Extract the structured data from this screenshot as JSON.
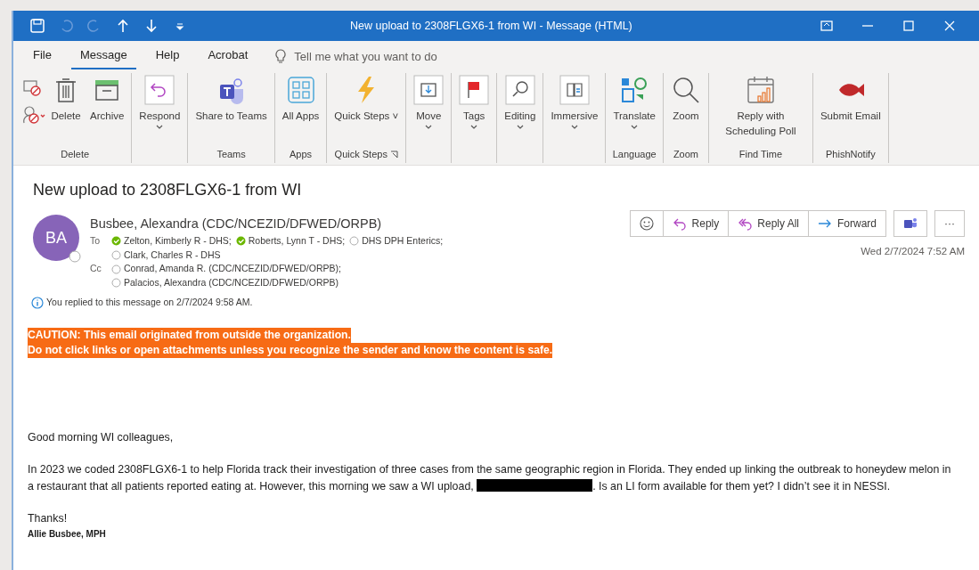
{
  "window": {
    "title": "New upload to 2308FLGX6-1 from WI  -  Message (HTML)"
  },
  "ribbon_tabs": [
    {
      "label": "File",
      "selected": false
    },
    {
      "label": "Message",
      "selected": true
    },
    {
      "label": "Help",
      "selected": false
    },
    {
      "label": "Acrobat",
      "selected": false
    }
  ],
  "tell_me": {
    "placeholder": "Tell me what you want to do"
  },
  "ribbon_groups": [
    {
      "label": "Delete",
      "buttons": [
        {
          "kind": "small-stack"
        },
        {
          "kind": "large",
          "label": "Delete",
          "dropdown": false
        },
        {
          "kind": "large",
          "label": "Archive",
          "dropdown": false
        }
      ]
    },
    {
      "buttons": [
        {
          "kind": "large",
          "label": "Respond",
          "dropdown": true
        }
      ]
    },
    {
      "label": "Teams",
      "buttons": [
        {
          "kind": "large",
          "label": "Share to Teams",
          "dropdown": false
        }
      ]
    },
    {
      "label": "Apps",
      "buttons": [
        {
          "kind": "large",
          "label": "All Apps",
          "dropdown": false
        }
      ]
    },
    {
      "label": "Quick Steps",
      "launcher": true,
      "buttons": [
        {
          "kind": "large",
          "label": "Quick Steps ˅",
          "dropdown": false
        }
      ]
    },
    {
      "buttons": [
        {
          "kind": "large",
          "label": "Move",
          "dropdown": true
        }
      ]
    },
    {
      "buttons": [
        {
          "kind": "large",
          "label": "Tags",
          "dropdown": true
        }
      ]
    },
    {
      "buttons": [
        {
          "kind": "large",
          "label": "Editing",
          "dropdown": true
        }
      ]
    },
    {
      "buttons": [
        {
          "kind": "large",
          "label": "Immersive",
          "dropdown": true
        }
      ]
    },
    {
      "label": "Language",
      "buttons": [
        {
          "kind": "large",
          "label": "Translate",
          "dropdown": true
        }
      ]
    },
    {
      "label": "Zoom",
      "buttons": [
        {
          "kind": "large",
          "label": "Zoom",
          "dropdown": false
        }
      ]
    },
    {
      "label": "Find Time",
      "buttons": [
        {
          "kind": "large",
          "label": "Reply with Scheduling Poll",
          "dropdown": false
        }
      ]
    },
    {
      "label": "PhishNotify",
      "buttons": [
        {
          "kind": "large",
          "label": "Submit Email",
          "dropdown": false
        }
      ]
    }
  ],
  "message": {
    "subject": "New upload to 2308FLGX6-1 from WI",
    "avatar_initials": "BA",
    "sender": "Busbee, Alexandra (CDC/NCEZID/DFWED/ORPB)",
    "to_label": "To",
    "to": [
      {
        "name": "Zelton, Kimberly R - DHS;",
        "online": true
      },
      {
        "name": "Roberts, Lynn T - DHS;",
        "online": true
      },
      {
        "name": "DHS DPH Enterics;",
        "online": false
      },
      {
        "name": "Clark, Charles R - DHS",
        "online": false
      }
    ],
    "cc_label": "Cc",
    "cc": [
      {
        "name": "Conrad, Amanda R. (CDC/NCEZID/DFWED/ORPB);",
        "online": false
      },
      {
        "name": "Palacios, Alexandra (CDC/NCEZID/DFWED/ORPB)",
        "online": false
      }
    ],
    "info": "You replied to this message on 2/7/2024 9:58 AM.",
    "actions": [
      "Reply",
      "Reply All",
      "Forward"
    ],
    "more_label": "···",
    "date": "Wed 2/7/2024 7:52 AM",
    "caution": [
      "CAUTION: This email originated from outside the organization.",
      "Do not click links or open attachments unless you recognize the sender and know the content is safe."
    ],
    "body": [
      {
        "kind": "text",
        "text": "Good morning WI colleagues,"
      },
      {
        "kind": "redacted-text",
        "before": "In 2023 we coded 2308FLGX6-1 to help Florida track their investigation of three cases from the same geographic region in Florida. They ended up linking the outbreak to honeydew melon in a restaurant that all patients reported eating at. However, this morning we saw a WI upload,",
        "after": ". Is an LI form available for them yet? I didn’t see it in NESSI."
      },
      {
        "kind": "text",
        "text": "Thanks!"
      },
      {
        "kind": "signature",
        "text": "Allie Busbee, MPH"
      }
    ]
  }
}
